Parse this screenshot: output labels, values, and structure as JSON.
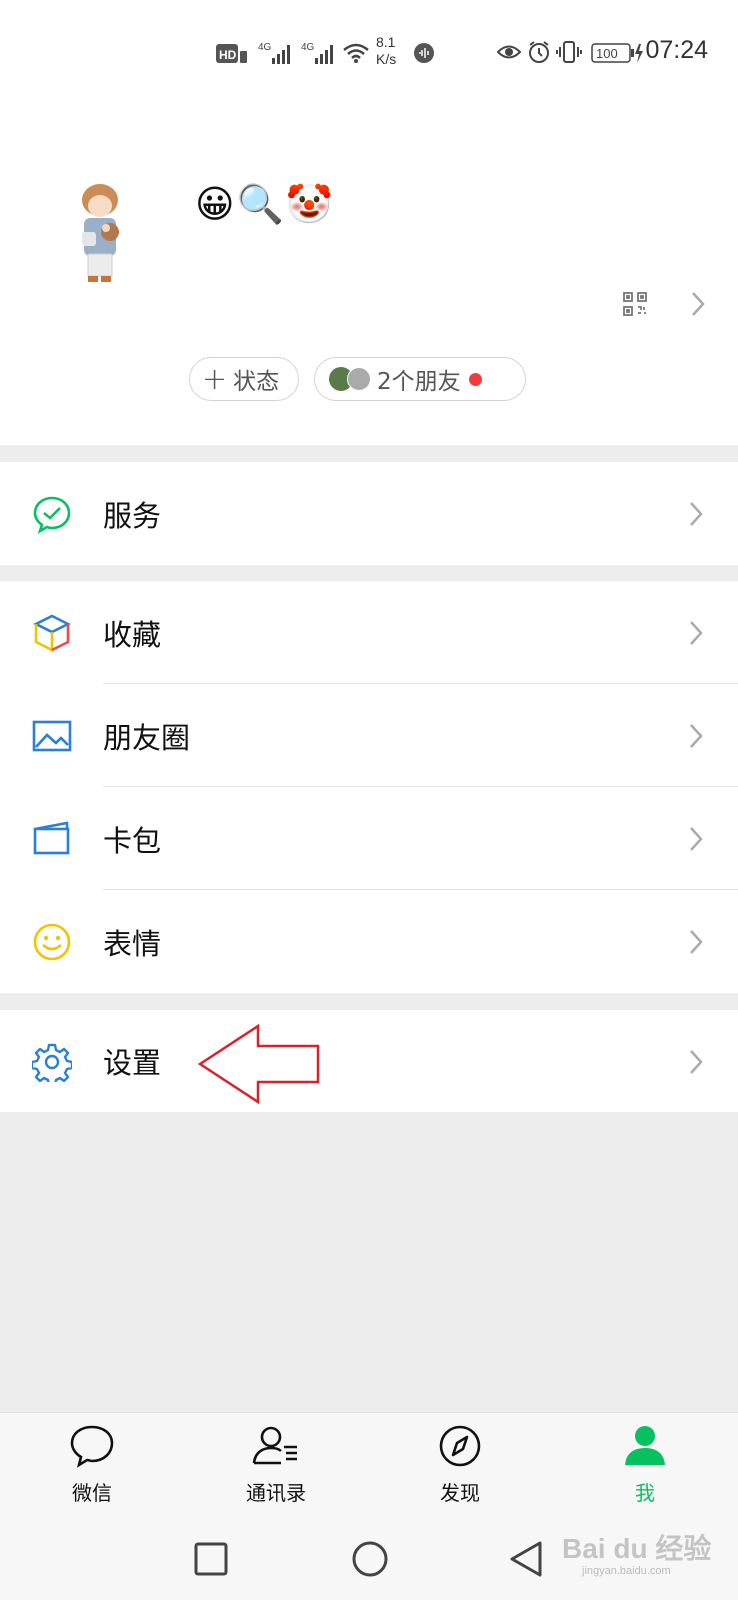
{
  "status_bar": {
    "hd_label": "HD",
    "net1": "4G",
    "net2": "4G",
    "speed_value": "8.1",
    "speed_unit": "K/s",
    "battery": "100",
    "time": "07:24"
  },
  "profile": {
    "emojis": "😀🔍🤡",
    "status_pill_label": "状态",
    "friends_pill_label": "2个朋友"
  },
  "menu": {
    "services": "服务",
    "favorites": "收藏",
    "moments": "朋友圈",
    "cards": "卡包",
    "stickers": "表情",
    "settings": "设置"
  },
  "tabbar": {
    "chats": "微信",
    "contacts": "通讯录",
    "discover": "发现",
    "me": "我"
  },
  "watermark": {
    "brand": "Bai du 经验",
    "url": "jingyan.baidu.com"
  },
  "colors": {
    "accent_green": "#07c160",
    "blue_icon": "#2b7fd4",
    "yellow_icon": "#f2c400",
    "annotation_red": "#d9212a"
  }
}
